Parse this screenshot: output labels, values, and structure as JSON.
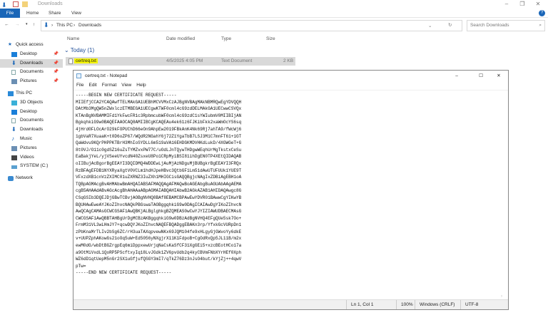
{
  "explorer": {
    "title": "Downloads",
    "ribbon_tabs": [
      "File",
      "Home",
      "Share",
      "View"
    ],
    "breadcrumb": [
      "This PC",
      "Downloads"
    ],
    "search_placeholder": "Search Downloads",
    "columns": [
      "Name",
      "Date modified",
      "Type",
      "Size"
    ],
    "group_label": "Today (1)",
    "file": {
      "name": "certreq.txt",
      "date": "4/5/2025 4:05 PM",
      "type": "Text Document",
      "size": "2 KB"
    },
    "sidebar": {
      "quick_access": "Quick access",
      "quick_items": [
        "Desktop",
        "Downloads",
        "Documents",
        "Pictures"
      ],
      "this_pc": "This PC",
      "pc_items": [
        "3D Objects",
        "Desktop",
        "Documents",
        "Downloads",
        "Music",
        "Pictures",
        "Videos",
        "SYSTEM (C:)"
      ],
      "network": "Network"
    }
  },
  "notepad": {
    "title": "certreq.txt - Notepad",
    "menu": [
      "File",
      "Edit",
      "Format",
      "View",
      "Help"
    ],
    "content": "-----BEGIN NEW CERTIFICATE REQUEST-----\nMIIEfjCCA2YCAQAwfTELMAkGA1UEBhMCVVMxCzAJBgNVBAgMAkNBMRQwEgYDVQQH\nDAtMb3MgQW5nZWxlczETMBEGA1UECgwKTWF0cml4cG9zdDELMAkGA1UECwwCSVQx\nKTAnBgNVBAMMIFd1YkFwcFR1c3RpbmcubWF0cml4cG9zdC1sYWIubmV0MIIBIjAN\nBgkqhkiG9w0BAQEFAAOCAQ8AMIIBCgKCAQEAu4ek61z6FJKibFkk2xaWmOcYS6sq\n4jHrd0FLOcArO29kFOPUChD66eOn9AhpEw2019FBkAnK4Nk69Rj7ahTA9/fWcWj6\n1gbVaR7XuaaK+t0D6oZP67/WQdR2NGahY6j72Z1YgaTbB7LSJ3M1C7mnFT61+1GT\nQaWdvu9KQrPHPPKTBrH3MhIoSYDLL6m519aVA16EHDGKMDVHKdLukD/4XGWGeT+G\n8t0VJ/O11c0gdSZ16uZsTYMZvxPW77C/uOdLJnTQywTHDgwWEqhUrMgTkstxCeSu\nEaBakjYeL/yjVSeeUYvcdN40ZsxeU8Po1CRpMyiBSI81ihDgEN0TP4XEtQIDAQAB\noIIBujAcBgorBgEEAYI3DQIDMQ4WDDEwLjAuMjAzNDguMjBUBgkrBgEEAYI3FRQx\nRzBFAgEFDB1NYXRyaXgtV0VCLm1hdHJpeHBvc3QtbGF1Lm51dAwUTUFUUk1YUE9T\nVFxzdXB1cnVzZXIMC01uZXRNZ3IuZXh1MHIGCisGAQQBgjcNAgIxZDBiAgEBH1oA\nTQBpAGMAcgBvAHMAbwBmAHQAIABSAFMAQQAgAFMAQwBoAGEAbgBuAGUAbAAgAEMA\ncgB5AHAAdABvAGcAcgBhAHAAaABpAGMAIABQAHIAbwB2AGkAZAB1AHIDAQAwgc8G\nCSqGSIb3DQEJDjGBwTCBvjAOBgNVHQ8BAf8EBAMCBPAwEwYDVR01BAwwCgYIKwYB\nBQUHAwEweAYJKoZIhvcNAQkPBGswaTAOBggqhkiG9w0DAgICAIAwDgYIKoZIhvcN\nAwQCAgCAMAsGCWCGSAF1AwQBKjALBglghkgBZQMEAS0wCwYJYIZIAWUDBAECMAsG\nCWCGSAF1AwQBBTAHBgUrDgMCBzAKBggqhkiG9w0DBzAdBgNVHQ4EFgQUe5sk7Oo+\nFrmM31VL3wLHmJY7+qcwDQYJKoZIhvcNAQEFBQADggEBAKn3rp/YfxkGcVURpDn1\nzPbKnaMrTLIv2bSg6ZC/rH3uaTAXqpvewNKx69JQM104fe9xHLgyGjGWvoYy6dkE\nv+UUPZphAKowGs21oOq5uW+Ed5056yNXgjrX11K1FdpoB+CgOdRxQp5JL11B/m2x\newM0dG/wbDtBGZrgpEq6miDppxewUrjqNaCsKaSfCF31XgGEi5+xzcBEotHCo17a\na9OtMiVxdL1QoRP5PScftxyIq18LvJGdk1ZV6pvUdb2q4kyCBVmFNbXYrHEf0Xph\nWZ6dD1qtUepM5nGr2SX1uGfjufQSGY3mI7/qTkZ76Dz3nJsO4but/kYjZj++4qwV\npTw=\n-----END NEW CERTIFICATE REQUEST-----",
    "status": {
      "position": "Ln 1, Col 1",
      "zoom": "100%",
      "line_ending": "Windows (CRLF)",
      "encoding": "UTF-8"
    }
  }
}
